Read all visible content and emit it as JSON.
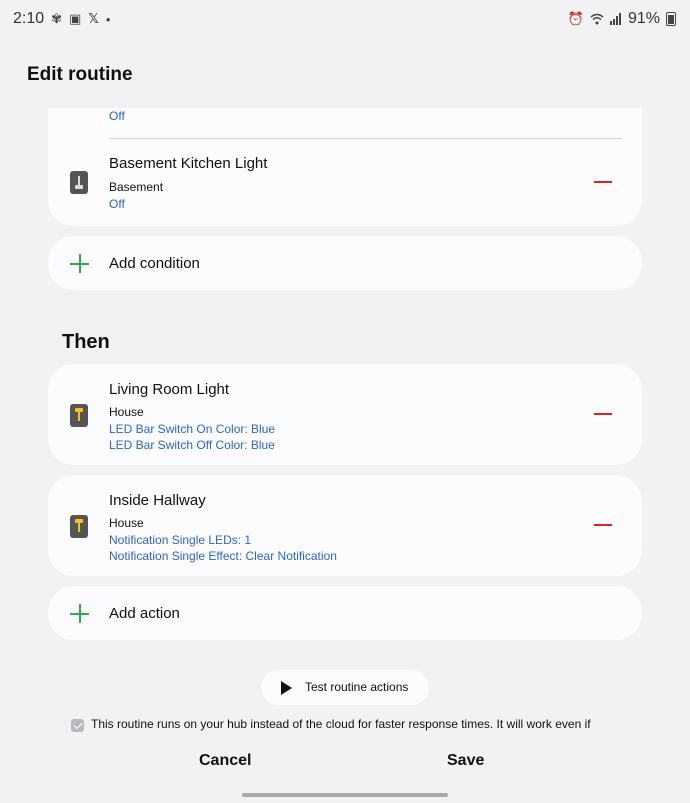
{
  "status_bar": {
    "time": "2:10",
    "left_icons": [
      "fan-icon",
      "gallery-icon",
      "x-icon"
    ],
    "dot": "•",
    "battery": "91%"
  },
  "header": {
    "title": "Edit routine"
  },
  "conditions": {
    "partial_item": {
      "state": "Off"
    },
    "items": [
      {
        "name": "Basement Kitchen Light",
        "room": "Basement",
        "states": [
          "Off"
        ]
      }
    ],
    "add_label": "Add condition"
  },
  "then": {
    "title": "Then",
    "items": [
      {
        "name": "Living Room Light",
        "room": "House",
        "states": [
          "LED Bar Switch On Color: Blue",
          "LED Bar Switch Off Color: Blue"
        ]
      },
      {
        "name": "Inside Hallway",
        "room": "House",
        "states": [
          "Notification Single LEDs: 1",
          "Notification Single Effect: Clear Notification"
        ]
      }
    ],
    "add_label": "Add action"
  },
  "test_button": {
    "label": "Test routine actions"
  },
  "notice": {
    "text": "This routine runs on your hub instead of the cloud for faster response times. It will work even if"
  },
  "footer": {
    "cancel": "Cancel",
    "save": "Save"
  },
  "colors": {
    "accent_blue": "#2e65c7",
    "remove_red": "#e0251b",
    "add_green": "#2fa84f"
  }
}
